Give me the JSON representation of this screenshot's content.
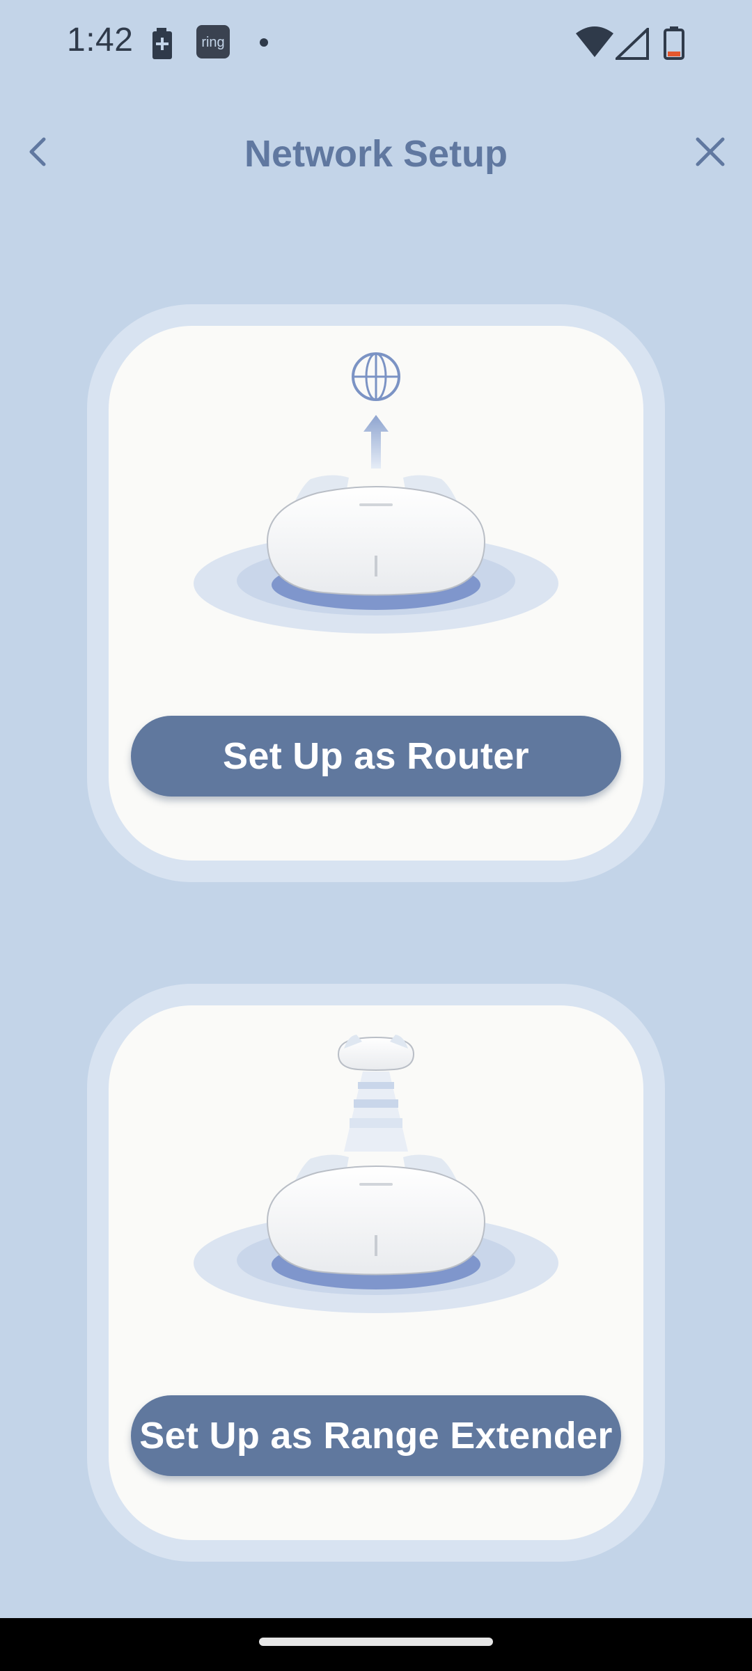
{
  "status_bar": {
    "time": "1:42",
    "notification_icons": [
      "battery-saver-icon",
      "ring-app-icon",
      "dot-icon"
    ],
    "ring_label": "ring",
    "system_icons": [
      "wifi-icon",
      "cellular-signal-icon",
      "battery-low-icon"
    ]
  },
  "header": {
    "title": "Network Setup",
    "back_icon": "chevron-left-icon",
    "close_icon": "close-icon"
  },
  "options": [
    {
      "button_label": "Set Up as Router",
      "illustration": "router-with-globe-illustration"
    },
    {
      "button_label": "Set Up as Range Extender",
      "illustration": "range-extender-illustration"
    }
  ],
  "colors": {
    "background": "#c3d4e8",
    "accent": "#60789e",
    "card": "#fafaf8"
  }
}
